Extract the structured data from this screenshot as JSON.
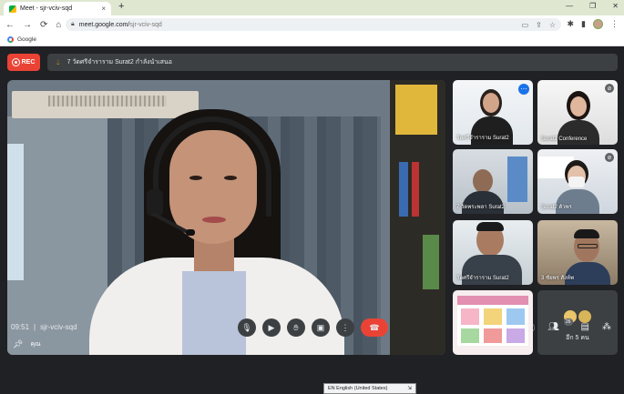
{
  "browser": {
    "tab_title": "Meet - sjr-vciv-sqd",
    "tab_close": "×",
    "new_tab": "+",
    "window_controls": [
      "—",
      "❐",
      "✕"
    ],
    "nav": [
      "←",
      "→",
      "⟳",
      "⌂"
    ],
    "url_host": "meet.google.com/",
    "url_path": "sjr-vciv-sqd",
    "bookmark": "Google"
  },
  "meet": {
    "rec_label": "REC",
    "presenting_text": "7 วัดศรีจำราราม Surat2 กำลังนำเสนอ",
    "main_name": "คุณ",
    "tiles": [
      {
        "name": "วัดศรีจำราราม Surat2",
        "color": "#e1e7ec"
      },
      {
        "name": "Surat2 Conference",
        "color": "#dddddd"
      },
      {
        "name": "7 วัดพระพลา Surat2",
        "color": "#b7c0c8"
      },
      {
        "name": "Surat2 ตัวพร",
        "color": "#cfd6de"
      },
      {
        "name": "วัดศรีจำราราม Surat2",
        "color": "#c6cfd4"
      },
      {
        "name": "3 ชัยพร สังห์พ",
        "color": "#8c7a66"
      },
      {
        "name": "",
        "color": "#f7eef0"
      }
    ],
    "others_label": "อีก 5 คน",
    "time": "09:51",
    "separator": "|",
    "meeting_code": "sjr-vciv-sqd",
    "people_count": "26",
    "language_indicator": "EN English (United States)"
  },
  "colors": {
    "rec": "#ea4335",
    "end_call": "#ea4335",
    "background": "#202124",
    "accent": "#1a73e8"
  },
  "icons": {
    "mic": "microphone-icon",
    "camera": "camera-icon",
    "hand": "raise-hand-icon",
    "present": "present-icon",
    "more": "more-options-icon",
    "end": "end-call-icon",
    "info": "info-icon",
    "people": "people-icon",
    "chat": "chat-icon",
    "activities": "activities-icon"
  }
}
